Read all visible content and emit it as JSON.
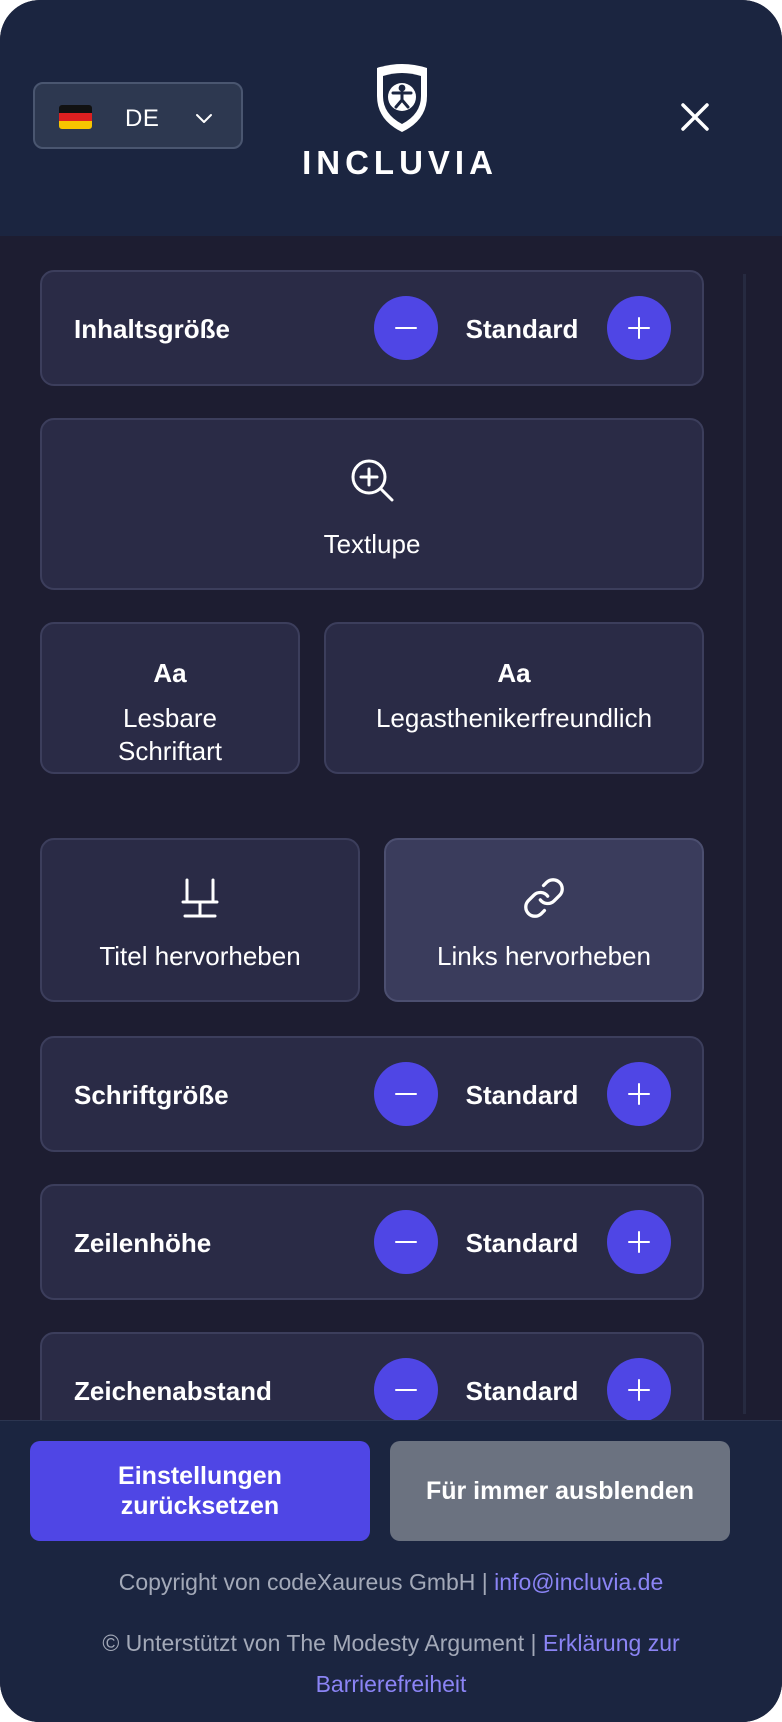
{
  "header": {
    "language": {
      "code": "DE",
      "flag": "germany-flag"
    },
    "logo_text": "INCLUVIA",
    "close_icon": "close-icon"
  },
  "controls": {
    "content_size": {
      "label": "Inhaltsgröße",
      "value": "Standard"
    },
    "text_magnifier": {
      "label": "Textlupe",
      "icon": "zoom-in-icon"
    },
    "readable_font": {
      "glyph": "Aa",
      "label_line1": "Lesbare",
      "label_line2": "Schriftart"
    },
    "dyslexia_font": {
      "glyph": "Aa",
      "label": "Legasthenikerfreundlich"
    },
    "highlight_titles": {
      "label": "Titel hervorheben",
      "icon": "heading-icon"
    },
    "highlight_links": {
      "label": "Links hervorheben",
      "icon": "link-icon"
    },
    "font_size": {
      "label": "Schriftgröße",
      "value": "Standard"
    },
    "line_height": {
      "label": "Zeilenhöhe",
      "value": "Standard"
    },
    "letter_spacing": {
      "label": "Zeichenabstand",
      "value": "Standard"
    }
  },
  "footer": {
    "reset_line1": "Einstellungen",
    "reset_line2": "zurücksetzen",
    "hide_forever": "Für immer ausblenden",
    "copyright_prefix": "Copyright von codeXaureus GmbH | ",
    "email": "info@incluvia.de",
    "support_prefix": "© Unterstützt von The Modesty Argument | ",
    "statement_link": "Erklärung zur Barrierefreiheit"
  },
  "colors": {
    "accent": "#4f46e5",
    "panel_bg": "#1d1d31",
    "header_bg": "#1b2540",
    "card_bg": "#2a2b46",
    "link": "#8b84f5",
    "secondary_button": "#6b7280"
  }
}
